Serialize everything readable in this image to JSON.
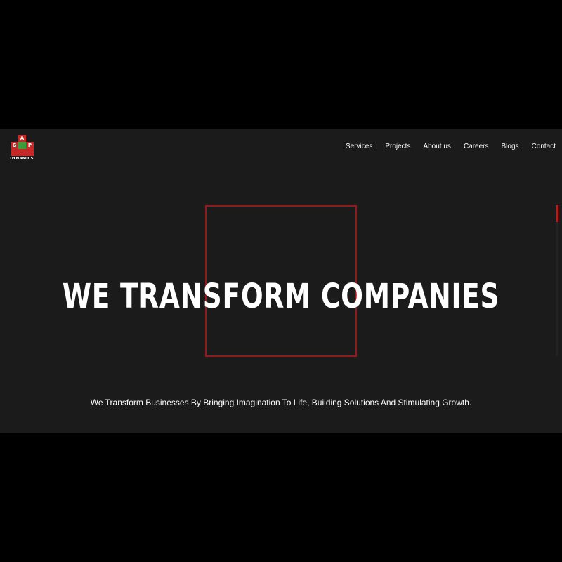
{
  "brand": {
    "tiles": [
      "A",
      "G",
      "P"
    ],
    "name": "DYNAMICS",
    "colors": {
      "red": "#c62828",
      "green": "#3a9d3a"
    }
  },
  "nav": {
    "items": [
      "Services",
      "Projects",
      "About us",
      "Careers",
      "Blogs",
      "Contact"
    ]
  },
  "hero": {
    "title": "WE TRANSFORM COMPANIES",
    "subtitle": "We Transform Businesses By Bringing Imagination To Life, Building Solutions And Stimulating Growth.",
    "frame_color": "#8e1c1c"
  },
  "colors": {
    "background": "#1b1b1b",
    "accent": "#b01f1f"
  }
}
